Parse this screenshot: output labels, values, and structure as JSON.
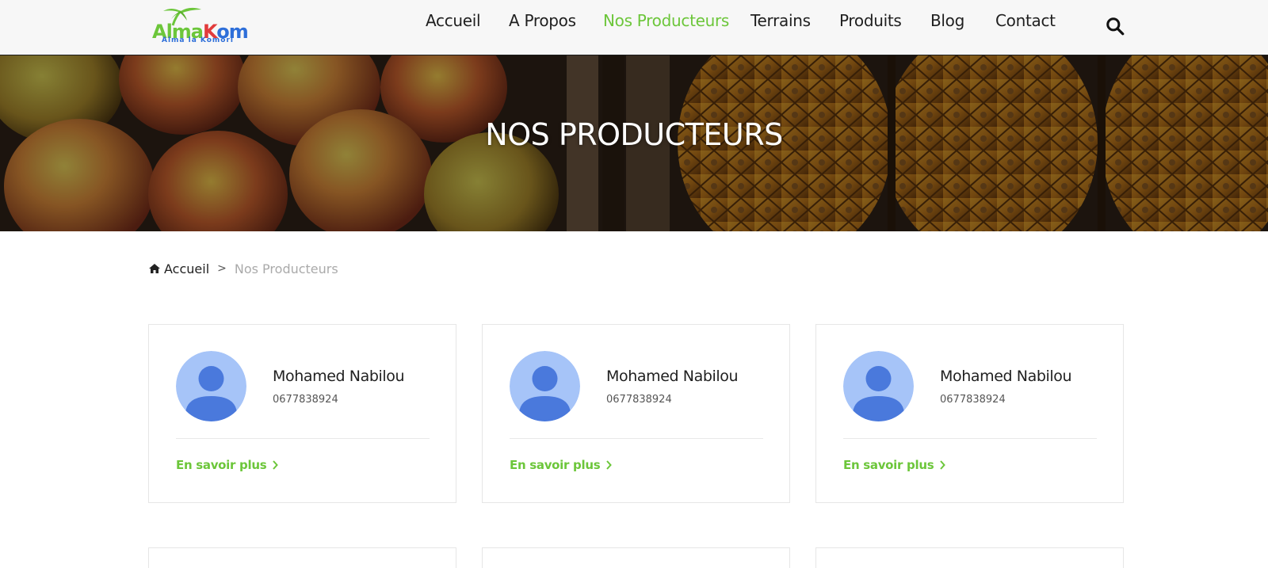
{
  "brand": {
    "logo_text": "AlmaKom",
    "logo_tagline": "Alma la Komori",
    "colors": {
      "green": "#6cc63a",
      "red": "#e23b3b",
      "blue": "#2e6fd9"
    }
  },
  "nav": {
    "items": [
      {
        "label": "Accueil",
        "active": false
      },
      {
        "label": "A Propos",
        "active": false
      },
      {
        "label": "Nos Producteurs",
        "active": true
      },
      {
        "label": "Terrains",
        "active": false
      },
      {
        "label": "Produits",
        "active": false
      },
      {
        "label": "Blog",
        "active": false
      },
      {
        "label": "Contact",
        "active": false
      }
    ],
    "search_icon": "search-icon",
    "accent_color": "#6cc63a"
  },
  "banner": {
    "title": "NOS PRODUCTEURS"
  },
  "breadcrumb": {
    "home_icon": "home-icon",
    "home_label": "Accueil",
    "separator": ">",
    "current": "Nos Producteurs"
  },
  "producers": [
    {
      "name": "Mohamed Nabilou",
      "phone": "0677838924",
      "link_label": "En savoir plus",
      "link_icon": "chevron-right-icon"
    },
    {
      "name": "Mohamed Nabilou",
      "phone": "0677838924",
      "link_label": "En savoir plus",
      "link_icon": "chevron-right-icon"
    },
    {
      "name": "Mohamed Nabilou",
      "phone": "0677838924",
      "link_label": "En savoir plus",
      "link_icon": "chevron-right-icon"
    }
  ]
}
